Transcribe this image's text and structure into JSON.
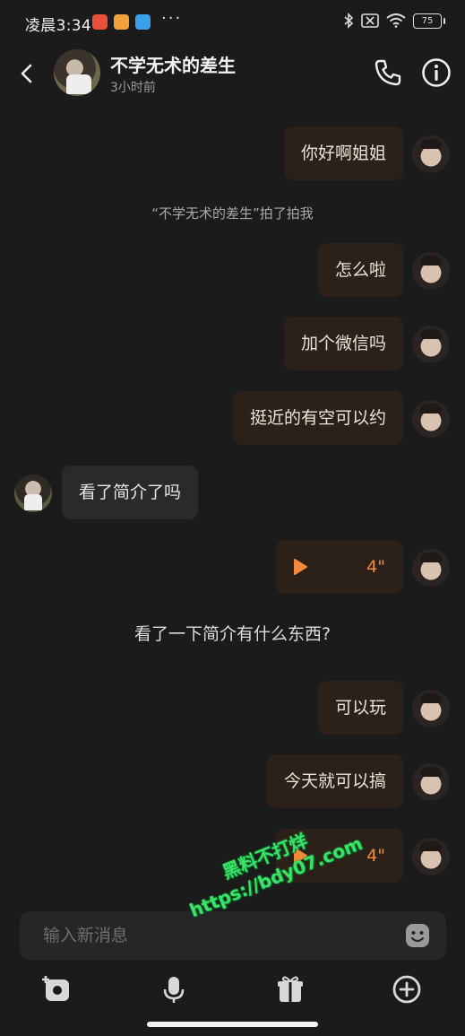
{
  "status_bar": {
    "time": "凌晨3:34",
    "dots": "···",
    "battery": "75"
  },
  "header": {
    "name": "不学无术的差生",
    "last_seen": "3小时前"
  },
  "messages": {
    "m1": "你好啊姐姐",
    "system_pat": "“不学无术的差生”拍了拍我",
    "m2": "怎么啦",
    "m3": "加个微信吗",
    "m4": "挺近的有空可以约",
    "m5": "看了简介了吗",
    "voice1_duration": "4\"",
    "m6": "看了一下简介有什么东西?",
    "m7": "可以玩",
    "m8": "今天就可以搞",
    "voice2_duration": "4\""
  },
  "input": {
    "placeholder": "输入新消息"
  },
  "watermark": {
    "line1": "黑料不打烊",
    "line2": "https://bdy07.com"
  },
  "colors": {
    "accent": "#f2883a",
    "outgoing_bubble": "#2c2118",
    "incoming_bubble": "#2a2a2a",
    "background": "#1b1b1b"
  }
}
